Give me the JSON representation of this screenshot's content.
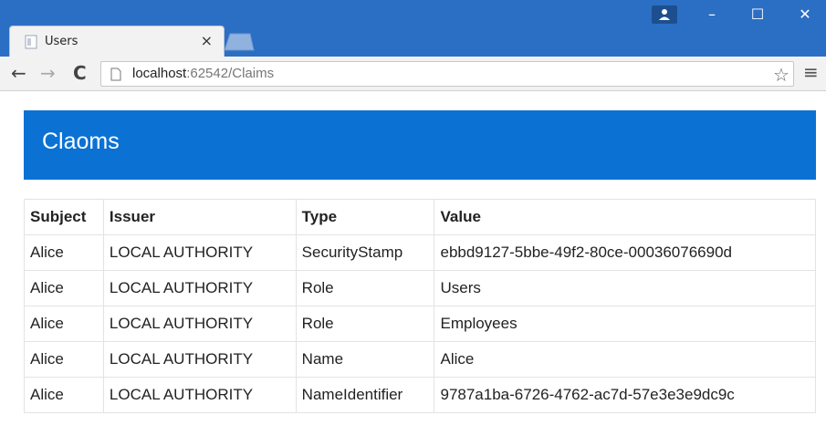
{
  "browser": {
    "tab_title": "Users",
    "tab_close": "×",
    "url_host": "localhost",
    "url_port_path": ":62542/Claims",
    "window_min": "–",
    "window_max": "☐",
    "window_close": "✕",
    "back": "←",
    "forward": "→",
    "reload": "C",
    "star": "☆",
    "menu": "≡"
  },
  "colors": {
    "chrome": "#2b6fc4",
    "header": "#0b72d4"
  },
  "page": {
    "title": "Claoms"
  },
  "table": {
    "headers": [
      "Subject",
      "Issuer",
      "Type",
      "Value"
    ],
    "rows": [
      [
        "Alice",
        "LOCAL AUTHORITY",
        "SecurityStamp",
        "ebbd9127-5bbe-49f2-80ce-00036076690d"
      ],
      [
        "Alice",
        "LOCAL AUTHORITY",
        "Role",
        "Users"
      ],
      [
        "Alice",
        "LOCAL AUTHORITY",
        "Role",
        "Employees"
      ],
      [
        "Alice",
        "LOCAL AUTHORITY",
        "Name",
        "Alice"
      ],
      [
        "Alice",
        "LOCAL AUTHORITY",
        "NameIdentifier",
        "9787a1ba-6726-4762-ac7d-57e3e3e9dc9c"
      ]
    ]
  }
}
